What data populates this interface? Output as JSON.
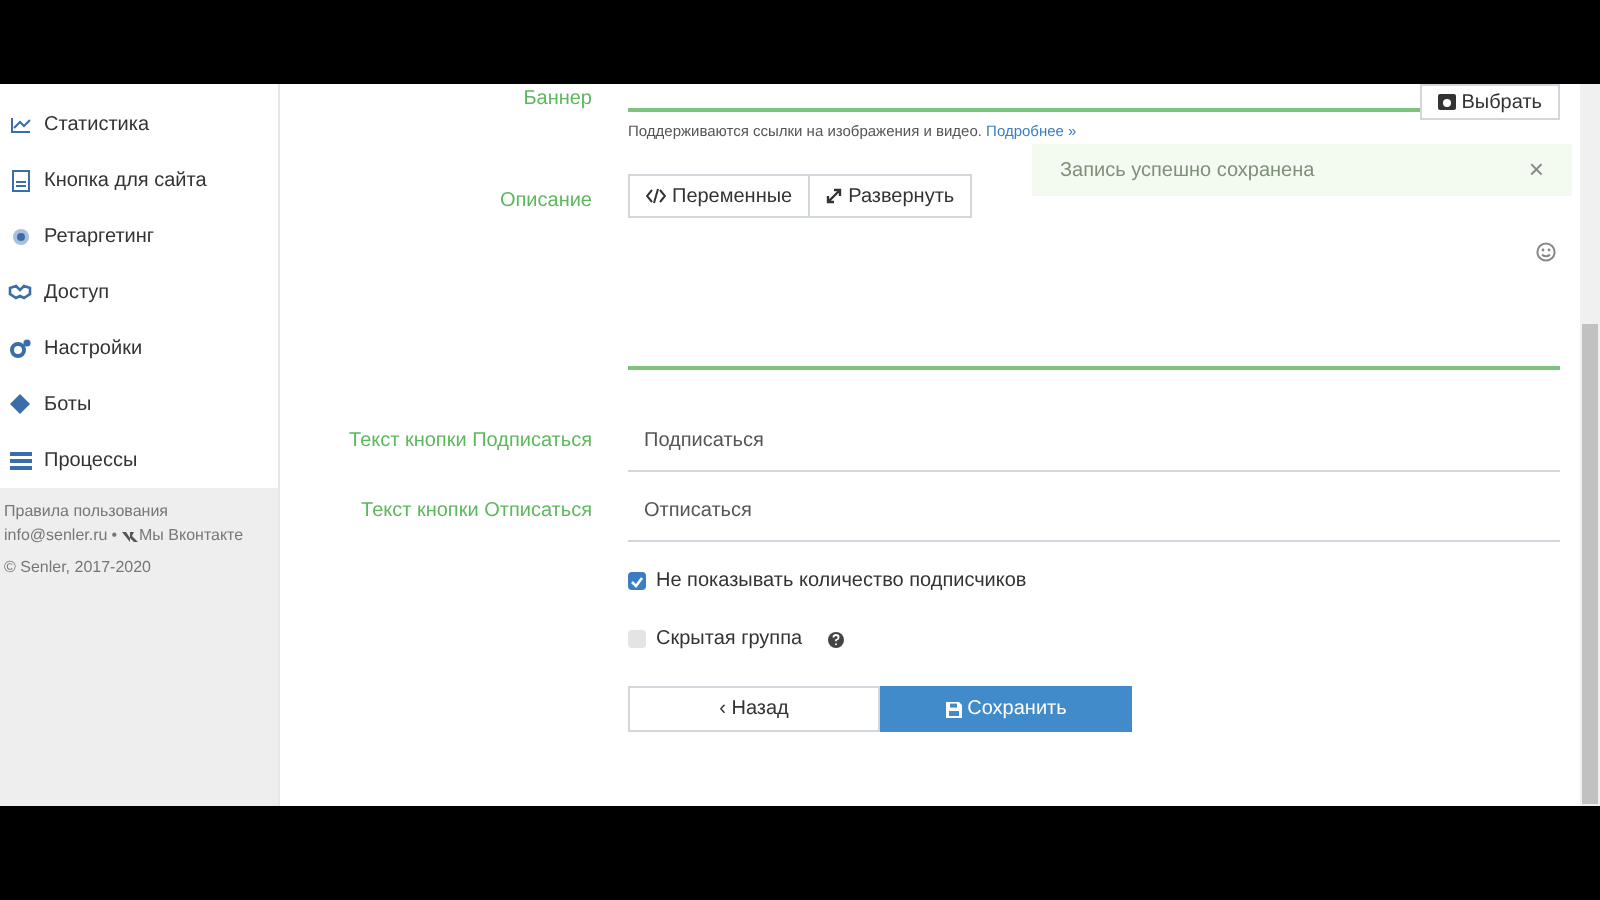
{
  "sidebar": {
    "items": [
      {
        "label": "Статистика",
        "selected": false
      },
      {
        "label": "Кнопка для сайта",
        "selected": false
      },
      {
        "label": "Ретаргетинг",
        "selected": false
      },
      {
        "label": "Доступ",
        "selected": false
      },
      {
        "label": "Настройки",
        "selected": false
      },
      {
        "label": "Боты",
        "selected": false
      },
      {
        "label": "Процессы",
        "selected": false
      }
    ],
    "footer": {
      "terms": "Правила пользования",
      "email": "info@senler.ru",
      "separator": "•",
      "vk": "Мы Вконтакте",
      "copyright": "© Senler, 2017-2020"
    }
  },
  "form": {
    "banner": {
      "label": "Баннер",
      "button": "Выбрать",
      "hint": "Поддерживаются ссылки на изображения и видео.",
      "hint_link": "Подробнее »"
    },
    "description": {
      "label": "Описание",
      "buttons": [
        "Переменные",
        "Развернуть"
      ]
    },
    "fields": [
      {
        "label": "Текст кнопки Подписаться",
        "value": "Подписаться"
      },
      {
        "label": "Текст кнопки Отписаться",
        "value": "Отписаться"
      }
    ],
    "checkboxes": [
      {
        "label": "Не показывать количество подписчиков",
        "checked": true,
        "help": false
      },
      {
        "label": "Скрытая группа",
        "checked": false,
        "help": true
      }
    ],
    "back": "‹ Назад",
    "save": "Сохранить"
  },
  "toast": {
    "text": "Запись успешно сохранена",
    "close": "×"
  }
}
